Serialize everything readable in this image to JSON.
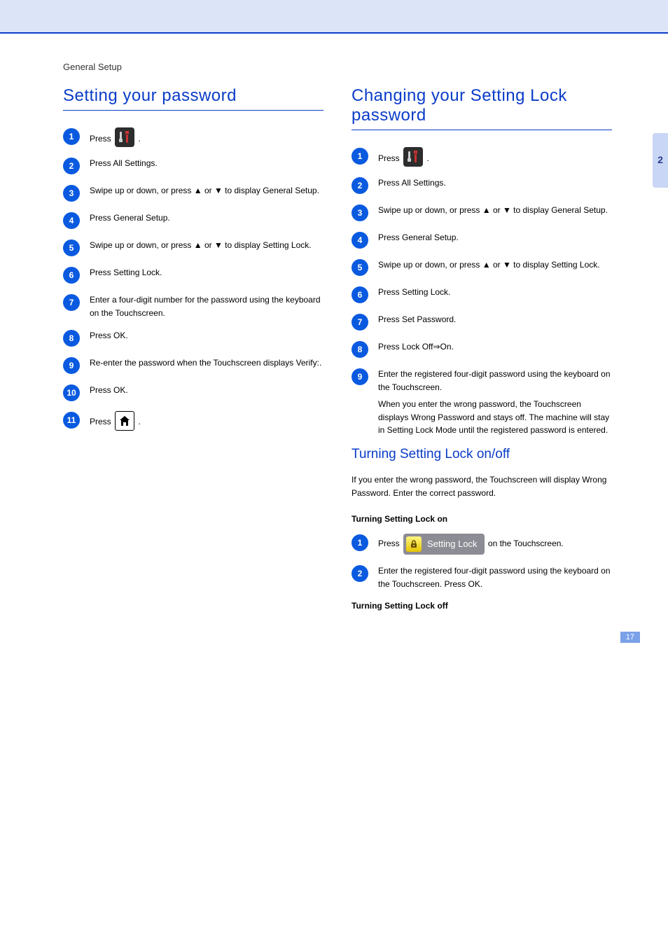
{
  "page_title": "General Setup",
  "side_tab": "2",
  "page_number": "17",
  "left": {
    "heading": "Setting your password",
    "steps": [
      {
        "pre": "Press ",
        "post": "."
      },
      {
        "text": "Press All Settings."
      },
      {
        "text": "Swipe up or down, or press ▲ or ▼ to display General Setup."
      },
      {
        "text": "Press General Setup."
      },
      {
        "text": "Swipe up or down, or press ▲ or ▼ to display Setting Lock."
      },
      {
        "text": "Press Setting Lock."
      },
      {
        "text": "Enter a four-digit number for the password using the keyboard on the Touchscreen."
      },
      {
        "text": "Press OK."
      },
      {
        "text": "Re-enter the password when the Touchscreen displays Verify:."
      },
      {
        "text": "Press OK."
      },
      {
        "pre": "Press ",
        "post": "."
      }
    ]
  },
  "right_top": {
    "heading": "Changing your Setting Lock password",
    "steps": [
      {
        "pre": "Press ",
        "post": "."
      },
      {
        "text": "Press All Settings."
      },
      {
        "text": "Swipe up or down, or press ▲ or ▼ to display General Setup."
      },
      {
        "text": "Press General Setup."
      },
      {
        "text": "Swipe up or down, or press ▲ or ▼ to display Setting Lock."
      },
      {
        "text": "Press Setting Lock."
      },
      {
        "text": "Press Set Password."
      },
      {
        "text": "Press Lock Off⇒On."
      },
      {
        "text": "Enter the registered four-digit password using the keyboard on the Touchscreen."
      }
    ],
    "note": "When you enter the wrong password, the Touchscreen displays Wrong Password and stays off. The machine will stay in Setting Lock Mode until the registered password is entered."
  },
  "right_bottom": {
    "heading": "Turning Setting Lock on/off",
    "intro": "If you enter the wrong password, the Touchscreen will display Wrong Password. Enter the correct password.",
    "sub_on": "Turning Setting Lock on",
    "sub_off": "Turning Setting Lock off",
    "on_steps": [
      {
        "pre": "Press ",
        "mid": " on the Touchscreen.",
        "lock_label": "Setting Lock"
      },
      {
        "text": "Enter the registered four-digit password using the keyboard on the Touchscreen. Press OK."
      }
    ]
  }
}
